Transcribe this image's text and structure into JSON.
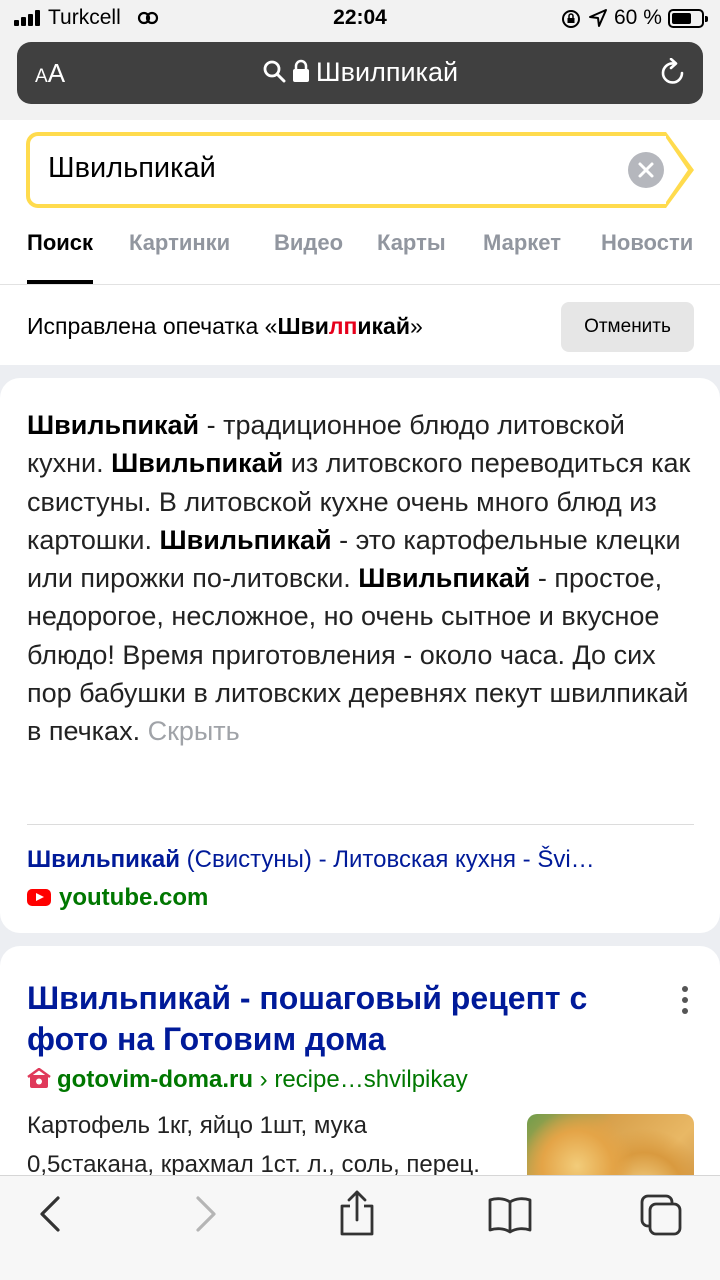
{
  "status_bar": {
    "carrier": "Turkcell",
    "time": "22:04",
    "battery_percent": "60 %",
    "battery_level": 0.6
  },
  "address_bar": {
    "text_size_label": "AA",
    "site_title": "Швилпикай"
  },
  "search": {
    "query": "Швильпикай",
    "tabs": [
      "Поиск",
      "Картинки",
      "Видео",
      "Карты",
      "Маркет",
      "Новости"
    ],
    "active_tab": "Поиск"
  },
  "typo_notice": {
    "prefix": "Исправлена опечатка «",
    "word_part1": "Шви",
    "word_error": "лп",
    "word_part2": "икай",
    "suffix": "»",
    "undo_label": "Отменить"
  },
  "fact": {
    "segments": [
      {
        "b": "Швильпикай"
      },
      {
        "t": " - традиционное блюдо литовской кухни. "
      },
      {
        "b": "Швильпикай"
      },
      {
        "t": " из литовского переводиться как свистуны. В литовской кухне очень много блюд из картошки. "
      },
      {
        "b": "Швильпикай"
      },
      {
        "t": " - это картофельные клецки или пирожки по-литовски. "
      },
      {
        "b": "Швильпикай"
      },
      {
        "t": " - простое, недорогое, несложное, но очень сытное и вкусное блюдо! Время приготовления - около часа. До сих пор бабушки в литовских деревнях пекут швилпикай в печках. "
      }
    ],
    "hide_label": "Скрыть",
    "source_title_bold": "Швильпикай",
    "source_title_rest": " (Свистуны) - Литовская кухня - Švi…",
    "source_domain": "youtube.com"
  },
  "result": {
    "title": "Швильпикай - пошаговый рецепт с фото на Готовим дома",
    "domain": "gotovim-doma.ru",
    "path": " › recipe…shvilpikay",
    "snippet": "Картофель 1кг, яйцо 1шт, мука 0,5стакана, крахмал 1ст. л., соль, перец. Картофель нужно отварить"
  },
  "colors": {
    "search_border": "#ffdb4d",
    "link": "#001a99",
    "url_green": "#007700",
    "typo_red": "#e6001b"
  },
  "icons": [
    "back-icon",
    "forward-icon",
    "share-icon",
    "bookmarks-icon",
    "tabs-icon",
    "reload-icon",
    "lock-icon",
    "search-icon",
    "clear-icon",
    "more-icon",
    "youtube-icon"
  ]
}
